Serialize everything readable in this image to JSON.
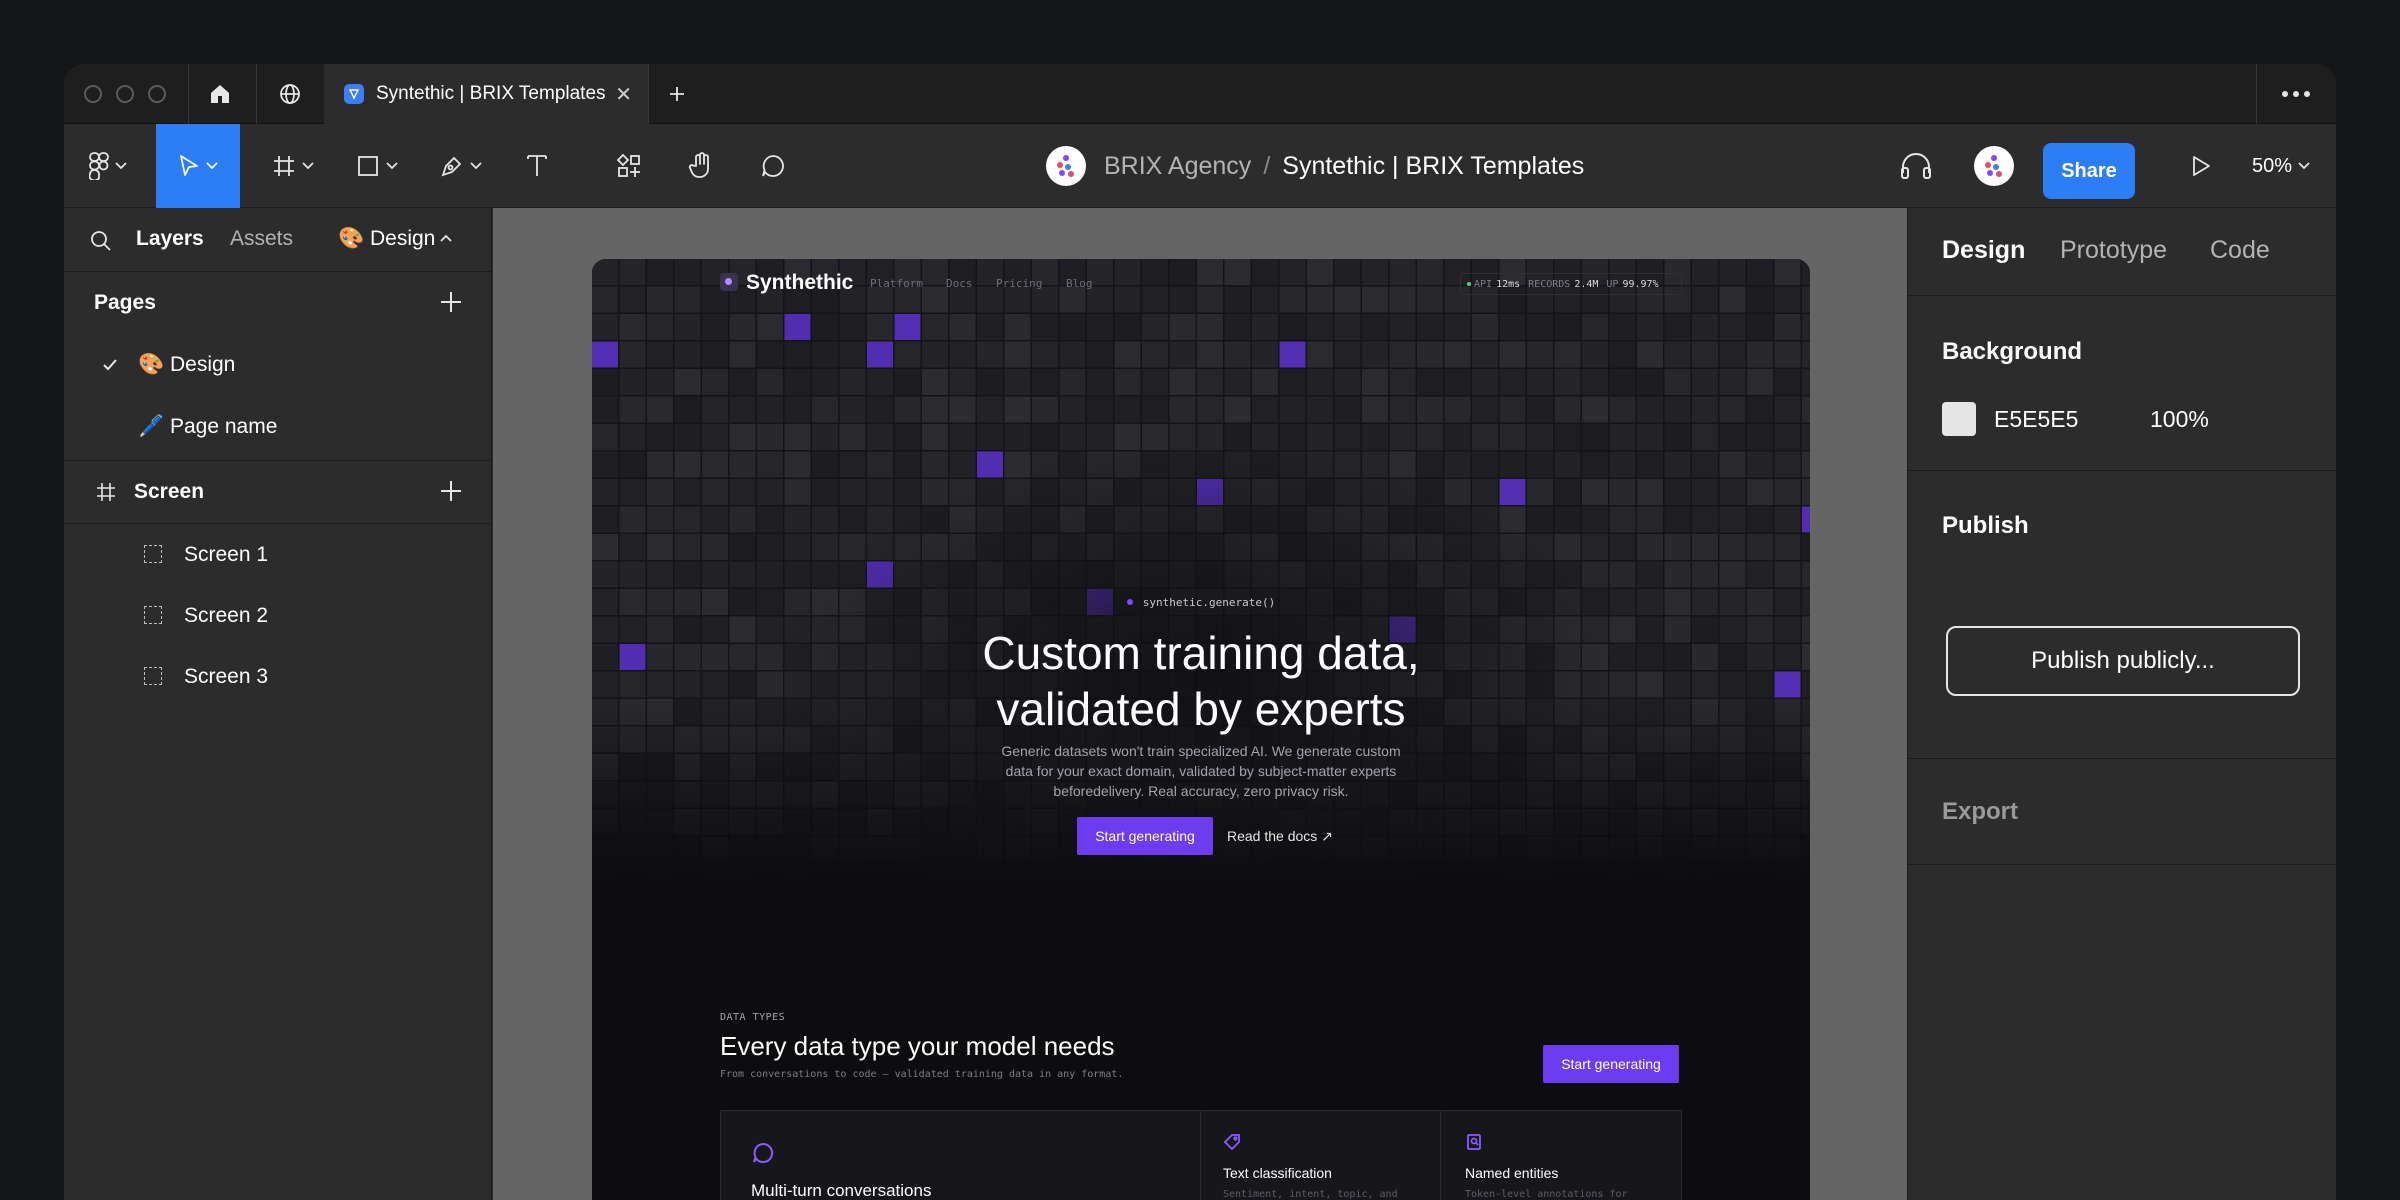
{
  "tabbar": {
    "active_tab_title": "Syntethic | BRIX Templates"
  },
  "toolbar": {
    "workspace": "BRIX Agency",
    "separator": "/",
    "file_name": "Syntethic | BRIX Templates",
    "share_label": "Share",
    "zoom": "50%"
  },
  "left_panel": {
    "tabs": [
      "Layers",
      "Assets"
    ],
    "page_switch": "🎨 Design",
    "pages_title": "Pages",
    "pages": [
      "🎨 Design",
      "🖊️ Page name"
    ],
    "screen_title": "Screen",
    "screens": [
      "Screen 1",
      "Screen 2",
      "Screen 3"
    ]
  },
  "right_panel": {
    "tabs": [
      "Design",
      "Prototype",
      "Code"
    ],
    "background_title": "Background",
    "bg_hex": "E5E5E5",
    "bg_opacity": "100%",
    "publish_title": "Publish",
    "publish_button": "Publish publicly...",
    "export_title": "Export"
  },
  "site": {
    "brand": "Synthethic",
    "nav": [
      "Platform",
      "Docs",
      "Pricing",
      "Blog"
    ],
    "stats": {
      "api_label": "API",
      "api_value": "12ms",
      "records_label": "RECORDS",
      "records_value": "2.4M",
      "up_label": "UP",
      "up_value": "99.97%"
    },
    "hero": {
      "eyebrow": "synthetic.generate()",
      "headline_1": "Custom training data,",
      "headline_2": "validated by experts",
      "sub": "Generic datasets won't train specialized AI. We generate custom data for your exact domain, validated by subject-matter experts beforedelivery. Real accuracy, zero privacy risk.",
      "cta": "Start generating",
      "docs": "Read the docs ↗"
    },
    "data_types": {
      "eyebrow": "DATA TYPES",
      "title": "Every data type your model needs",
      "sub": "From conversations to code — validated training data in any format.",
      "cta": "Start generating",
      "cards": [
        {
          "title": "Multi-turn conversations",
          "desc": ""
        },
        {
          "title": "Text classification",
          "desc": "Sentiment, intent, topic, and"
        },
        {
          "title": "Named entities",
          "desc": "Token-level annotations for"
        }
      ]
    }
  },
  "colors": {
    "accent": "#2d7df6",
    "brand_purple": "#6c3cf0"
  }
}
